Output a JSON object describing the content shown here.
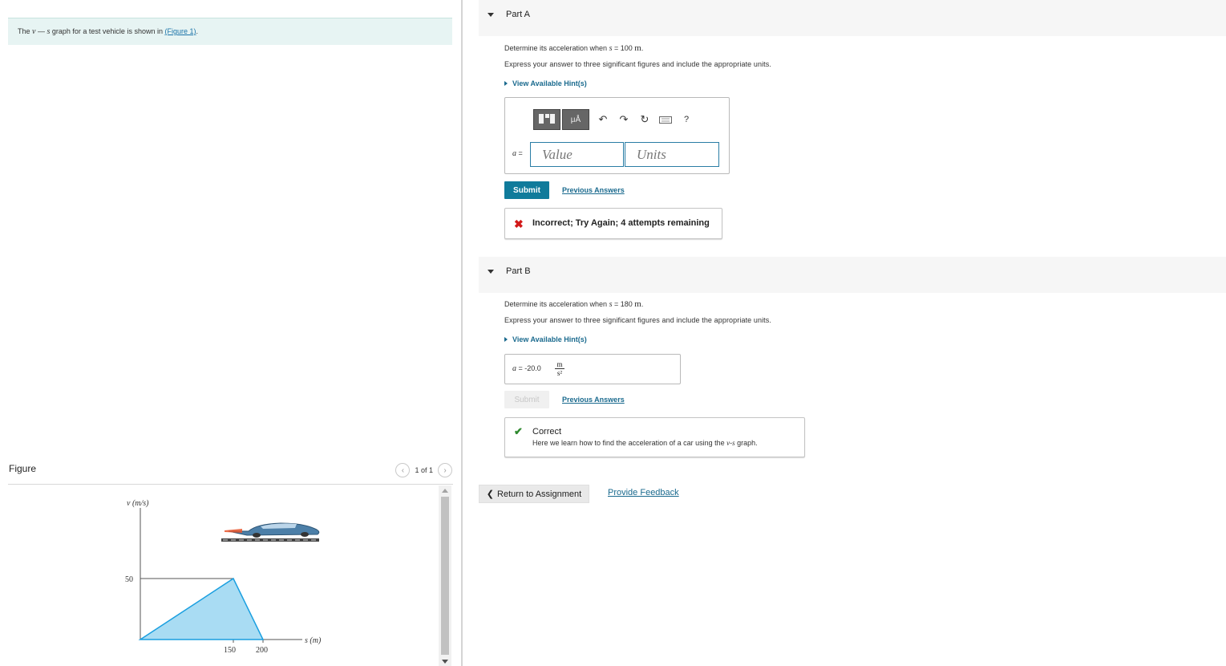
{
  "problem": {
    "prefix": "The ",
    "v": "v",
    "dash": " — ",
    "s": "s",
    "mid": " graph for a test vehicle is shown in ",
    "link": "(Figure 1)",
    "suffix": "."
  },
  "figure": {
    "title": "Figure",
    "page_indicator": "1 of 1",
    "y_axis_label": "v (m/s)",
    "x_axis_label": "s (m)",
    "y_tick": "50",
    "x_ticks": [
      "150",
      "200"
    ],
    "graph": {
      "v_peak": 50,
      "s_peak": 150,
      "s_end": 200
    }
  },
  "part_a": {
    "title": "Part A",
    "question_prefix": "Determine its acceleration when ",
    "var": "s",
    "question_eq": " = 100 ",
    "question_unit": "m",
    "question_suffix": ".",
    "instructions": "Express your answer to three significant figures and include the appropriate units.",
    "hint_label": "View Available Hint(s)",
    "answer_var": "a",
    "answer_eq": " =",
    "value_placeholder": "Value",
    "units_placeholder": "Units",
    "toolbar": {
      "templates_label": "▪▪",
      "mu_label": "μÅ",
      "help_label": "?"
    },
    "submit_label": "Submit",
    "previous_answers_label": "Previous Answers",
    "feedback": "Incorrect; Try Again; 4 attempts remaining"
  },
  "part_b": {
    "title": "Part B",
    "question_prefix": "Determine its acceleration when ",
    "var": "s",
    "question_eq": " = 180 ",
    "question_unit": "m",
    "question_suffix": ".",
    "instructions": "Express your answer to three significant figures and include the appropriate units.",
    "hint_label": "View Available Hint(s)",
    "answer_var": "a",
    "answer_eq": " = ",
    "answer_value": "-20.0",
    "answer_unit_num": "m",
    "answer_unit_den": "s²",
    "submit_label": "Submit",
    "previous_answers_label": "Previous Answers",
    "feedback_title": "Correct",
    "feedback_prefix": "Here we learn how to find the acceleration of a car using the ",
    "feedback_v": "v",
    "feedback_dash": "-",
    "feedback_s": "s",
    "feedback_suffix": " graph."
  },
  "footer": {
    "return_label": "Return to Assignment",
    "feedback_label": "Provide Feedback"
  },
  "colors": {
    "accent": "#107b9b",
    "link": "#1a6a8e",
    "problem_bg": "#e7f4f3",
    "error": "#d21919",
    "success": "#2f8a2f",
    "graph_fill": "#a9dcf3",
    "graph_stroke": "#1a9fe0"
  }
}
